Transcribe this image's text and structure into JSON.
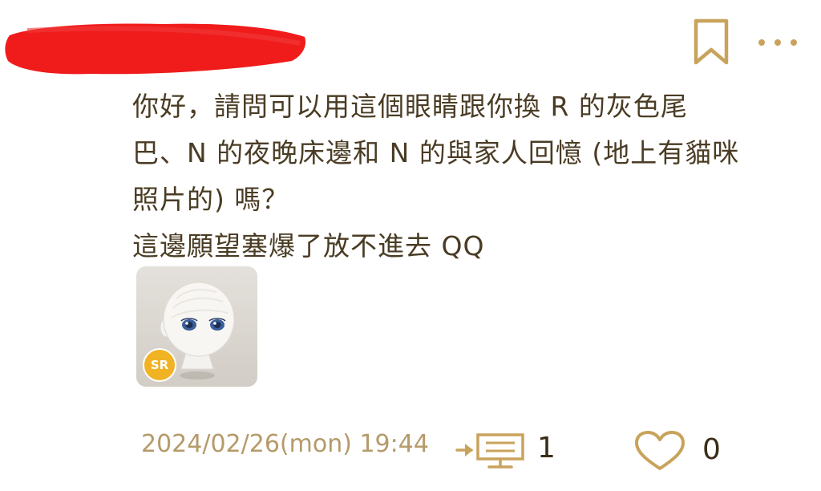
{
  "post": {
    "lines": [
      "你好，請問可以用這個眼睛跟你換 R 的灰色尾",
      "巴、N 的夜晚床邊和 N 的與家人回憶 (地上有貓咪",
      "照片的) 嗎？",
      "這邊願望塞爆了放不進去 QQ"
    ],
    "sticker_badge": "SR",
    "timestamp": "2024/02/26(mon) 19:44",
    "reply_count": "1",
    "like_count": "0"
  },
  "icons": {
    "bookmark": "bookmark-icon",
    "more": "more-options-icon",
    "reply": "reply-icon",
    "like": "heart-icon"
  },
  "colors": {
    "accent": "#c8a35c",
    "text": "#4a3c24",
    "timestamp": "#b59a6a",
    "badge": "#f1b324",
    "redaction": "#f01c1c"
  }
}
